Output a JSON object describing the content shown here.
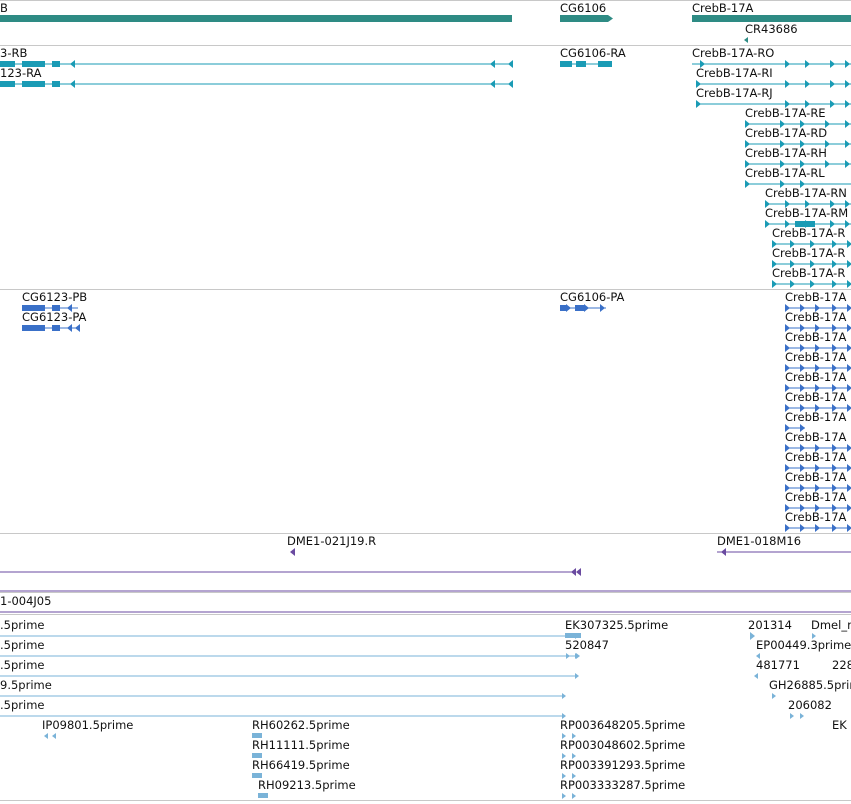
{
  "colors": {
    "gene": "#2e8b84",
    "transcript": "#1a9bb5",
    "protein": "#3a70c8",
    "bac": "#6a4aa0",
    "est": "#7ab3d8",
    "divider": "#c8c8c8"
  },
  "tracks": {
    "genes": {
      "items": [
        {
          "label": "B",
          "id": "gene-creb-a"
        },
        {
          "label": "CG6106",
          "id": "gene-cg6106"
        },
        {
          "label": "CrebB-17A",
          "id": "gene-crebb17a"
        },
        {
          "label": "CR43686",
          "id": "gene-cr43686"
        }
      ]
    },
    "transcripts": {
      "items": [
        {
          "label": "3-RB"
        },
        {
          "label": "123-RA"
        },
        {
          "label": "CG6106-RA"
        },
        {
          "label": "CrebB-17A-RO"
        },
        {
          "label": "CrebB-17A-RI"
        },
        {
          "label": "CrebB-17A-RJ"
        },
        {
          "label": "CrebB-17A-RE"
        },
        {
          "label": "CrebB-17A-RD"
        },
        {
          "label": "CrebB-17A-RH"
        },
        {
          "label": "CrebB-17A-RL"
        },
        {
          "label": "CrebB-17A-RN"
        },
        {
          "label": "CrebB-17A-RM"
        },
        {
          "label": "CrebB-17A-R"
        },
        {
          "label": "CrebB-17A-R"
        },
        {
          "label": "CrebB-17A-R"
        }
      ]
    },
    "proteins": {
      "items": [
        {
          "label": "CG6123-PB"
        },
        {
          "label": "CG6123-PA"
        },
        {
          "label": "CG6106-PA"
        },
        {
          "label": "CrebB-17A"
        },
        {
          "label": "CrebB-17A"
        },
        {
          "label": "CrebB-17A"
        },
        {
          "label": "CrebB-17A"
        },
        {
          "label": "CrebB-17A"
        },
        {
          "label": "CrebB-17A"
        },
        {
          "label": "CrebB-17A"
        },
        {
          "label": "CrebB-17A"
        },
        {
          "label": "CrebB-17A"
        },
        {
          "label": "CrebB-17A"
        },
        {
          "label": "CrebB-17A"
        },
        {
          "label": "CrebB-17A"
        }
      ]
    },
    "bacs": {
      "items": [
        {
          "label": "DME1-021J19.R"
        },
        {
          "label": "DME1-018M16"
        },
        {
          "label": "1-004J05"
        }
      ]
    },
    "ests": {
      "items": [
        {
          "label": ".5prime"
        },
        {
          "label": "EK307325.5prime"
        },
        {
          "label": "201314"
        },
        {
          "label": "Dmel_r"
        },
        {
          "label": ".5prime"
        },
        {
          "label": "520847"
        },
        {
          "label": "EP00449.3prime"
        },
        {
          "label": ".5prime"
        },
        {
          "label": "481771"
        },
        {
          "label": "228"
        },
        {
          "label": "9.5prime"
        },
        {
          "label": "GH26885.5prime"
        },
        {
          "label": ".5prime"
        },
        {
          "label": "206082"
        },
        {
          "label": "IP09801.5prime"
        },
        {
          "label": "RH60262.5prime"
        },
        {
          "label": "RP003648205.5prime"
        },
        {
          "label": "EK"
        },
        {
          "label": "RH11111.5prime"
        },
        {
          "label": "RP003048602.5prime"
        },
        {
          "label": "RH66419.5prime"
        },
        {
          "label": "RP003391293.5prime"
        },
        {
          "label": "RH09213.5prime"
        },
        {
          "label": "RP003333287.5prime"
        }
      ]
    }
  }
}
